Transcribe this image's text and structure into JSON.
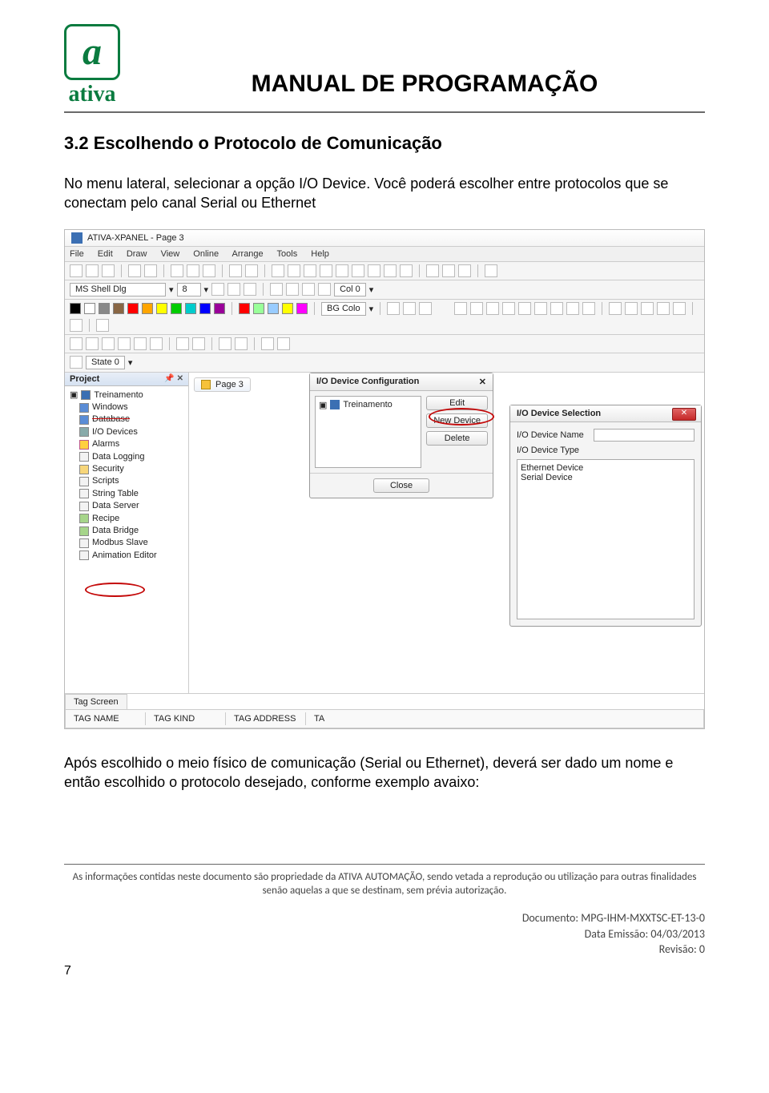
{
  "logo": {
    "letter": "a",
    "brand": "ativa"
  },
  "doc_title": "MANUAL DE PROGRAMAÇÃO",
  "section_heading": "3.2  Escolhendo o Protocolo de Comunicação",
  "para1": "No menu lateral, selecionar a opção I/O Device. Você poderá escolher entre protocolos que se conectam pelo canal Serial ou Ethernet",
  "para2": "Após escolhido o meio físico de comunicação (Serial ou Ethernet), deverá ser dado um nome e então escolhido o protocolo desejado, conforme exemplo avaixo:",
  "app": {
    "title": "ATIVA-XPANEL - Page 3",
    "menu": [
      "File",
      "Edit",
      "Draw",
      "View",
      "Online",
      "Arrange",
      "Tools",
      "Help"
    ],
    "font_name": "MS Shell Dlg",
    "font_size": "8",
    "col_label": "Col 0",
    "bg_label": "BG Colo",
    "state_label": "State 0",
    "project_panel_title": "Project",
    "tree": {
      "root": "Treinamento",
      "items": [
        "Windows",
        "Database",
        "I/O Devices",
        "Alarms",
        "Data Logging",
        "Security",
        "Scripts",
        "String Table",
        "Data Server",
        "Recipe",
        "Data Bridge",
        "Modbus Slave",
        "Animation Editor"
      ]
    },
    "page_tab": "Page 3",
    "io_dialog": {
      "title": "I/O Device Configuration",
      "item": "Treinamento",
      "buttons": [
        "Edit",
        "New Device",
        "Delete"
      ],
      "close": "Close"
    },
    "sel_dialog": {
      "title": "I/O Device Selection",
      "name_label": "I/O Device Name",
      "type_label": "I/O Device Type",
      "types": [
        "Ethernet Device",
        "Serial Device"
      ]
    },
    "tag_tab": "Tag Screen",
    "tag_headers": [
      "TAG NAME",
      "TAG KIND",
      "TAG ADDRESS",
      "TA"
    ]
  },
  "footnote": "As informações contidas neste documento são propriedade da ATIVA AUTOMAÇÃO, sendo vetada a reprodução ou utilização para outras finalidades senão aquelas a que se destinam, sem prévia autorização.",
  "meta": {
    "doc_line": "Documento: MPG-IHM-MXXTSC-ET-13-0",
    "date_line": "Data Emissão: 04/03/2013",
    "rev_line": "Revisão:  0"
  },
  "page_number": "7"
}
